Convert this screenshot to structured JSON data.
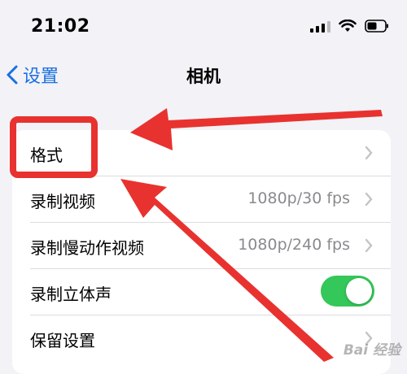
{
  "status_bar": {
    "time": "21:02",
    "icons": [
      "signal-icon",
      "wifi-icon",
      "battery-icon"
    ]
  },
  "nav": {
    "back_label": "设置",
    "title": "相机"
  },
  "settings": [
    {
      "label": "格式",
      "value": "",
      "control": "chevron"
    },
    {
      "label": "录制视频",
      "value": "1080p/30 fps",
      "control": "chevron"
    },
    {
      "label": "录制慢动作视频",
      "value": "1080p/240 fps",
      "control": "chevron"
    },
    {
      "label": "录制立体声",
      "value": "",
      "control": "toggle",
      "on": true
    },
    {
      "label": "保留设置",
      "value": "",
      "control": "chevron"
    }
  ],
  "colors": {
    "accent": "#1a6fe0",
    "toggle_on": "#34c759",
    "annotation": "#e8322f",
    "background": "#f2f2f7"
  },
  "watermark": "Bai 经验"
}
